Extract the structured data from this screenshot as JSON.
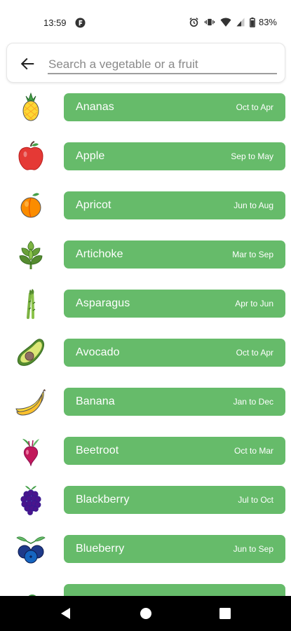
{
  "status_bar": {
    "time": "13:59",
    "battery": "83%"
  },
  "search": {
    "placeholder": "Search a vegetable or a fruit",
    "value": ""
  },
  "items": [
    {
      "name": "Ananas",
      "season": "Oct to Apr",
      "icon": "pineapple-icon"
    },
    {
      "name": "Apple",
      "season": "Sep to May",
      "icon": "apple-icon"
    },
    {
      "name": "Apricot",
      "season": "Jun to Aug",
      "icon": "apricot-icon"
    },
    {
      "name": "Artichoke",
      "season": "Mar to Sep",
      "icon": "artichoke-icon"
    },
    {
      "name": "Asparagus",
      "season": "Apr to Jun",
      "icon": "asparagus-icon"
    },
    {
      "name": "Avocado",
      "season": "Oct to Apr",
      "icon": "avocado-icon"
    },
    {
      "name": "Banana",
      "season": "Jan to Dec",
      "icon": "banana-icon"
    },
    {
      "name": "Beetroot",
      "season": "Oct to Mar",
      "icon": "beetroot-icon"
    },
    {
      "name": "Blackberry",
      "season": "Jul to Oct",
      "icon": "blackberry-icon"
    },
    {
      "name": "Blueberry",
      "season": "Jun to Sep",
      "icon": "blueberry-icon"
    }
  ],
  "colors": {
    "pill": "#66bb6a",
    "pill_text": "#ffffff",
    "nav_bar": "#000000"
  },
  "nav": {
    "back_icon": "triangle-back-icon",
    "home_icon": "circle-home-icon",
    "recents_icon": "square-recents-icon"
  }
}
